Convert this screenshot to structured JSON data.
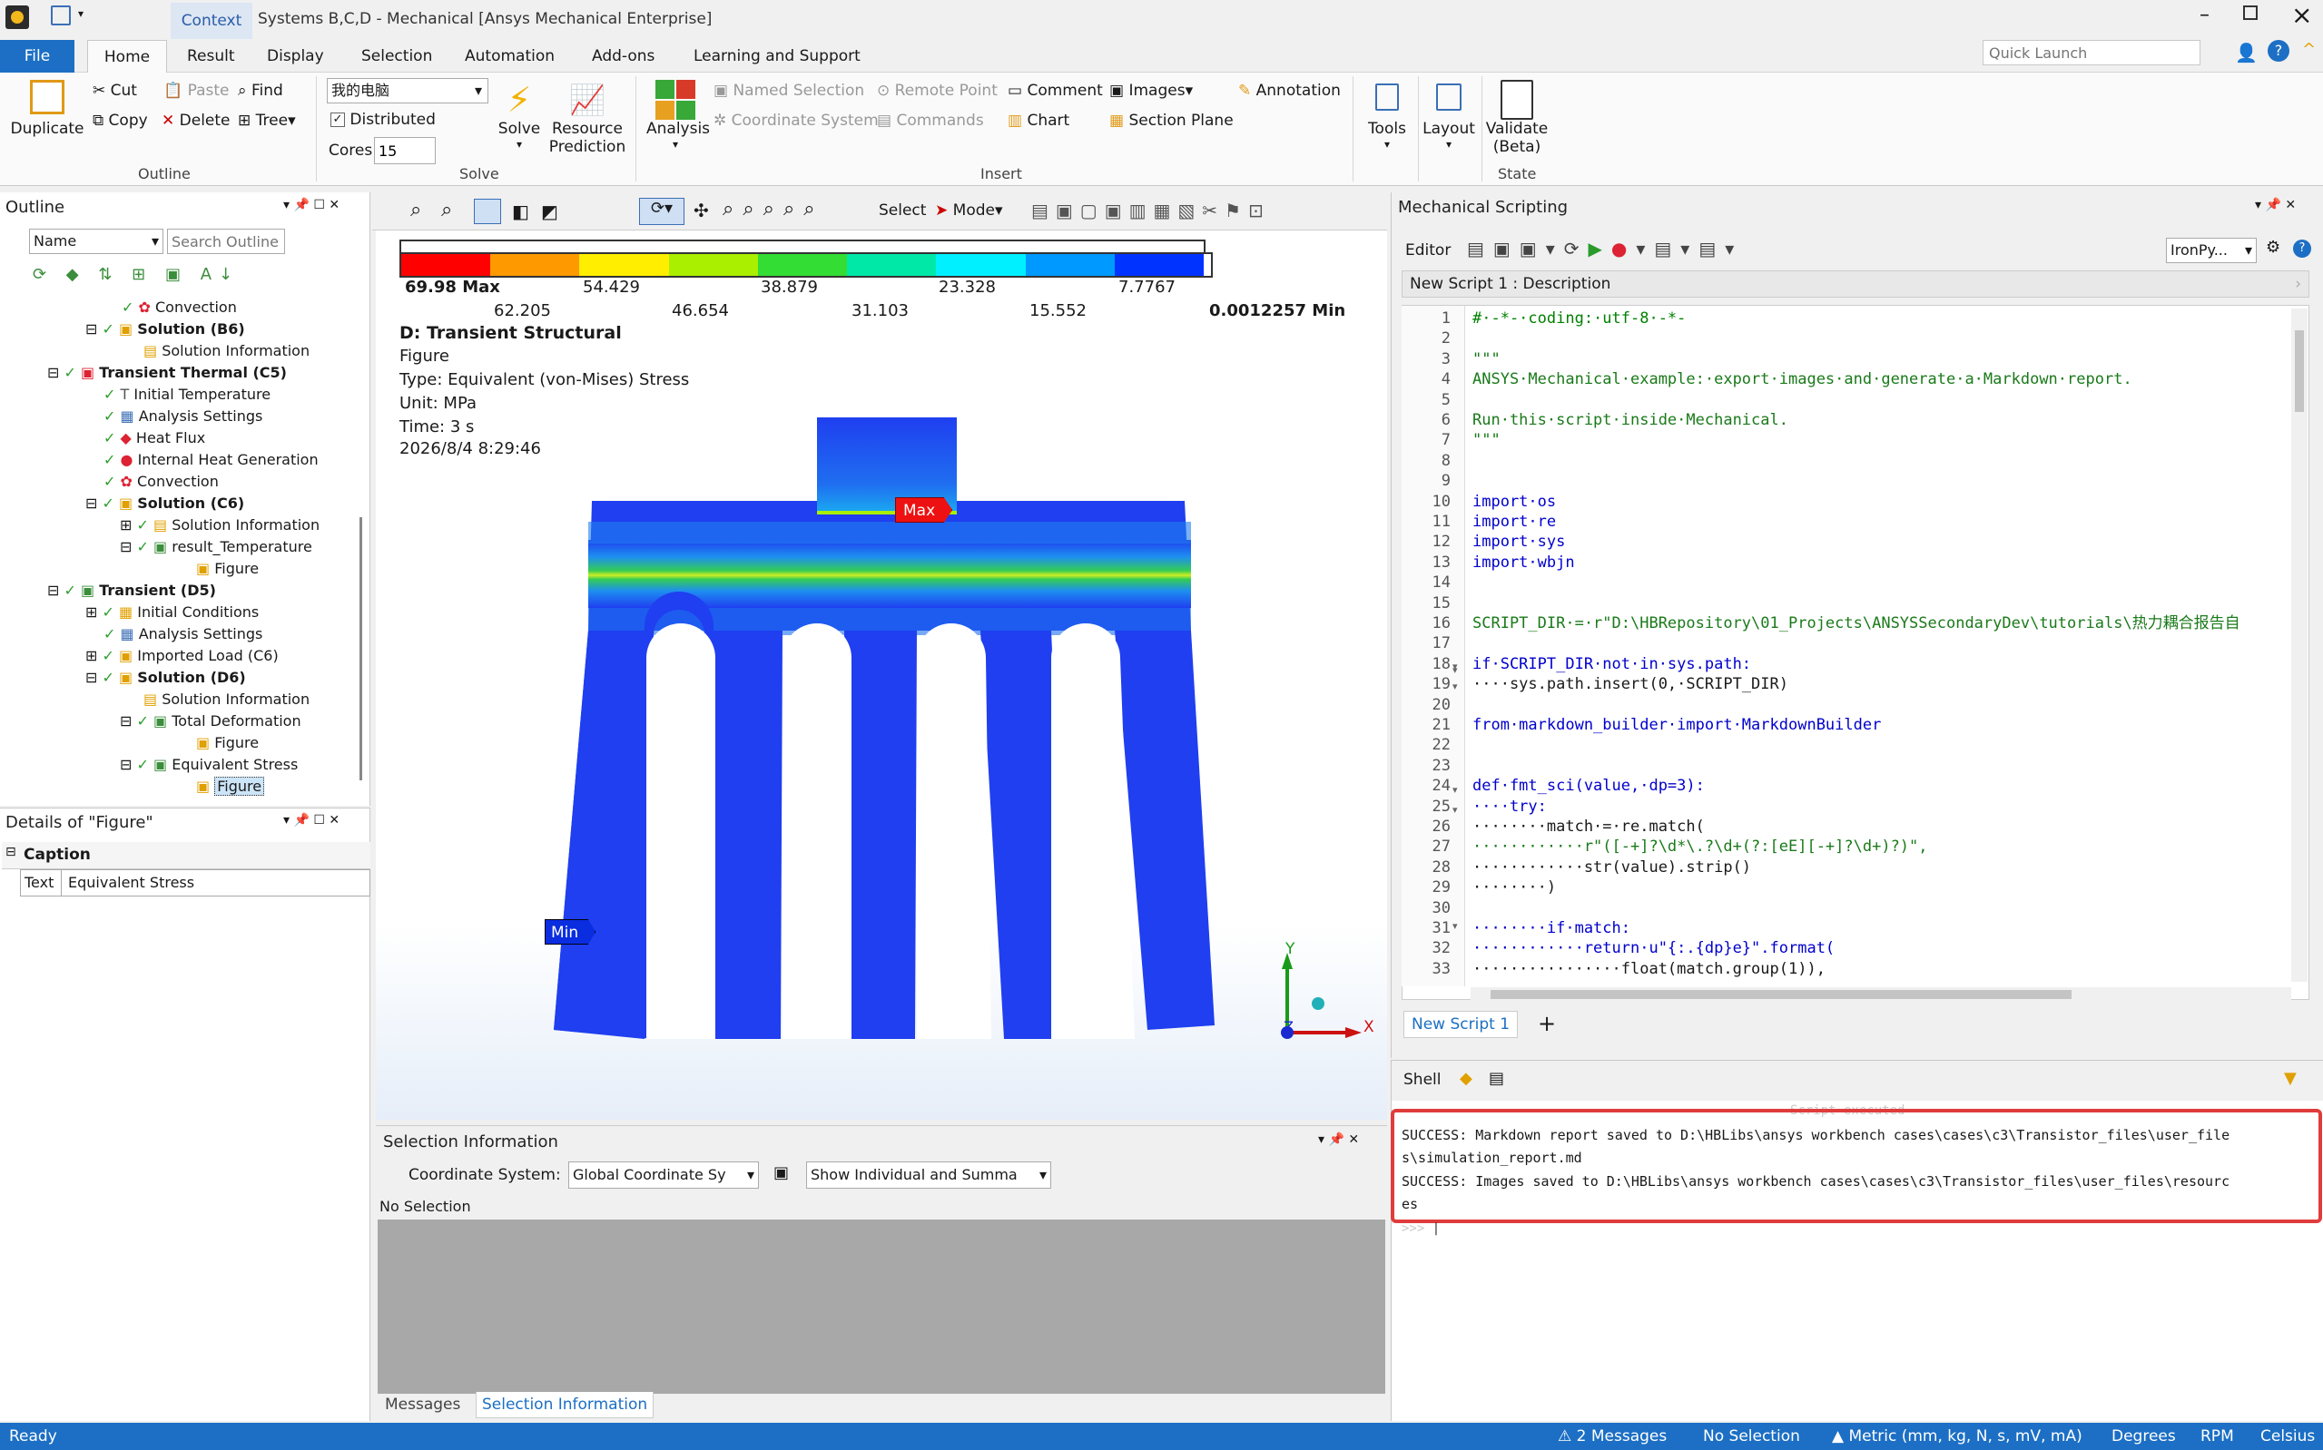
{
  "title": {
    "context_tab": "Context",
    "window_title": "Systems B,C,D - Mechanical [Ansys Mechanical Enterprise]"
  },
  "menu": {
    "file": "File",
    "tabs": [
      "Home",
      "Result",
      "Display",
      "Selection",
      "Automation",
      "Add-ons",
      "Learning and Support"
    ],
    "quick_launch_placeholder": "Quick Launch"
  },
  "ribbon": {
    "outline": {
      "duplicate": "Duplicate",
      "cut": "Cut",
      "copy": "Copy",
      "paste": "Paste",
      "delete": "Delete",
      "find": "Find",
      "tree": "Tree",
      "label": "Outline"
    },
    "solve": {
      "host": "我的电脑",
      "distributed": "Distributed",
      "cores_label": "Cores",
      "cores_value": "15",
      "solve": "Solve",
      "resource_prediction": "Resource Prediction",
      "label": "Solve"
    },
    "insert": {
      "analysis": "Analysis",
      "named_selection": "Named Selection",
      "coordinate_system": "Coordinate System",
      "remote_point": "Remote Point",
      "commands": "Commands",
      "comment": "Comment",
      "chart": "Chart",
      "images": "Images",
      "section_plane": "Section Plane",
      "annotation": "Annotation",
      "label": "Insert"
    },
    "tools": "Tools",
    "layout": "Layout",
    "validate": "Validate (Beta)",
    "state_label": "State"
  },
  "outline": {
    "title": "Outline",
    "name_field": "Name",
    "search_placeholder": "Search Outline",
    "items": [
      {
        "label": "Convection",
        "bold": false
      },
      {
        "label": "Solution (B6)",
        "bold": true
      },
      {
        "label": "Solution Information",
        "bold": false
      },
      {
        "label": "Transient Thermal (C5)",
        "bold": true
      },
      {
        "label": "Initial Temperature",
        "bold": false
      },
      {
        "label": "Analysis Settings",
        "bold": false
      },
      {
        "label": "Heat Flux",
        "bold": false
      },
      {
        "label": "Internal Heat Generation",
        "bold": false
      },
      {
        "label": "Convection",
        "bold": false
      },
      {
        "label": "Solution (C6)",
        "bold": true
      },
      {
        "label": "Solution Information",
        "bold": false
      },
      {
        "label": "result_Temperature",
        "bold": false
      },
      {
        "label": "Figure",
        "bold": false
      },
      {
        "label": "Transient (D5)",
        "bold": true
      },
      {
        "label": "Initial Conditions",
        "bold": false
      },
      {
        "label": "Analysis Settings",
        "bold": false
      },
      {
        "label": "Imported Load (C6)",
        "bold": false
      },
      {
        "label": "Solution (D6)",
        "bold": true
      },
      {
        "label": "Solution Information",
        "bold": false
      },
      {
        "label": "Total Deformation",
        "bold": false
      },
      {
        "label": "Figure",
        "bold": false
      },
      {
        "label": "Equivalent Stress",
        "bold": false
      },
      {
        "label": "Figure",
        "bold": false
      }
    ]
  },
  "details": {
    "title": "Details of \"Figure\"",
    "section": "Caption",
    "key": "Text",
    "value": "Equivalent Stress"
  },
  "viewport": {
    "select_label": "Select",
    "mode_label": "Mode",
    "legend_top": [
      "69.98 Max",
      "54.429",
      "38.879",
      "23.328",
      "7.7767"
    ],
    "legend_bottom": [
      "62.205",
      "46.654",
      "31.103",
      "15.552",
      "0.0012257 Min"
    ],
    "legend_colors": [
      "#ff0000",
      "#ff9900",
      "#ffee00",
      "#aaee00",
      "#33dd33",
      "#00e8a8",
      "#00f0ff",
      "#0099ff",
      "#0033ff"
    ],
    "header": "D: Transient Structural",
    "lines": [
      "Figure",
      "Type: Equivalent (von-Mises) Stress",
      "Unit: MPa",
      "Time: 3 s",
      "2026/8/4 8:29:46"
    ],
    "max_tag": "Max",
    "min_tag": "Min",
    "axis_y": "Y",
    "axis_x": "X",
    "axis_z": "Z"
  },
  "selection_info": {
    "title": "Selection Information",
    "coord_label": "Coordinate System:",
    "coord_value": "Global Coordinate Sy",
    "show_value": "Show Individual and Summa",
    "status": "No Selection",
    "tab_messages": "Messages",
    "tab_selection": "Selection Information"
  },
  "scripting": {
    "title": "Mechanical Scripting",
    "editor_label": "Editor",
    "language": "IronPy...",
    "description": "New Script 1 : Description",
    "tab": "New Script 1",
    "line_numbers": [
      "1",
      "2",
      "3",
      "4",
      "5",
      "6",
      "7",
      "8",
      "9",
      "10",
      "11",
      "12",
      "13",
      "14",
      "15",
      "16",
      "17",
      "18",
      "19",
      "20",
      "21",
      "22",
      "23",
      "24",
      "25",
      "26",
      "27",
      "28",
      "29",
      "30",
      "31",
      "32",
      "33"
    ],
    "code": [
      "#·-*-·coding:·utf-8·-*-",
      "",
      "\"\"\"",
      "ANSYS·Mechanical·example:·export·images·and·generate·a·Markdown·report.",
      "",
      "Run·this·script·inside·Mechanical.",
      "\"\"\"",
      "",
      "",
      "import·os",
      "import·re",
      "import·sys",
      "import·wbjn",
      "",
      "",
      "SCRIPT_DIR·=·r\"D:\\HBRepository\\01_Projects\\ANSYSSecondaryDev\\tutorials\\热力耦合报告自",
      "",
      "if·SCRIPT_DIR·not·in·sys.path:",
      "····sys.path.insert(0,·SCRIPT_DIR)",
      "",
      "from·markdown_builder·import·MarkdownBuilder",
      "",
      "",
      "def·fmt_sci(value,·dp=3):",
      "····try:",
      "········match·=·re.match(",
      "············r\"([-+]?\\d*\\.?\\d+(?:[eE][-+]?\\d+)?)\",",
      "············str(value).strip()",
      "········)",
      "",
      "········if·match:",
      "············return·u\"{:.{dp}e}\".format(",
      "················float(match.group(1)),"
    ]
  },
  "shell": {
    "title": "Shell",
    "faded": "Script executed",
    "lines": [
      "SUCCESS: Markdown report saved to D:\\HBLibs\\ansys workbench cases\\cases\\c3\\Transistor_files\\user_file",
      "s\\simulation_report.md",
      "SUCCESS: Images saved to D:\\HBLibs\\ansys workbench cases\\cases\\c3\\Transistor_files\\user_files\\resourc",
      "es"
    ],
    "prompt": ">>>"
  },
  "statusbar": {
    "ready": "Ready",
    "messages": "2 Messages",
    "selection": "No Selection",
    "units": "Metric (mm, kg, N, s, mV, mA)",
    "angle": "Degrees",
    "rpm": "RPM",
    "temp": "Celsius"
  }
}
